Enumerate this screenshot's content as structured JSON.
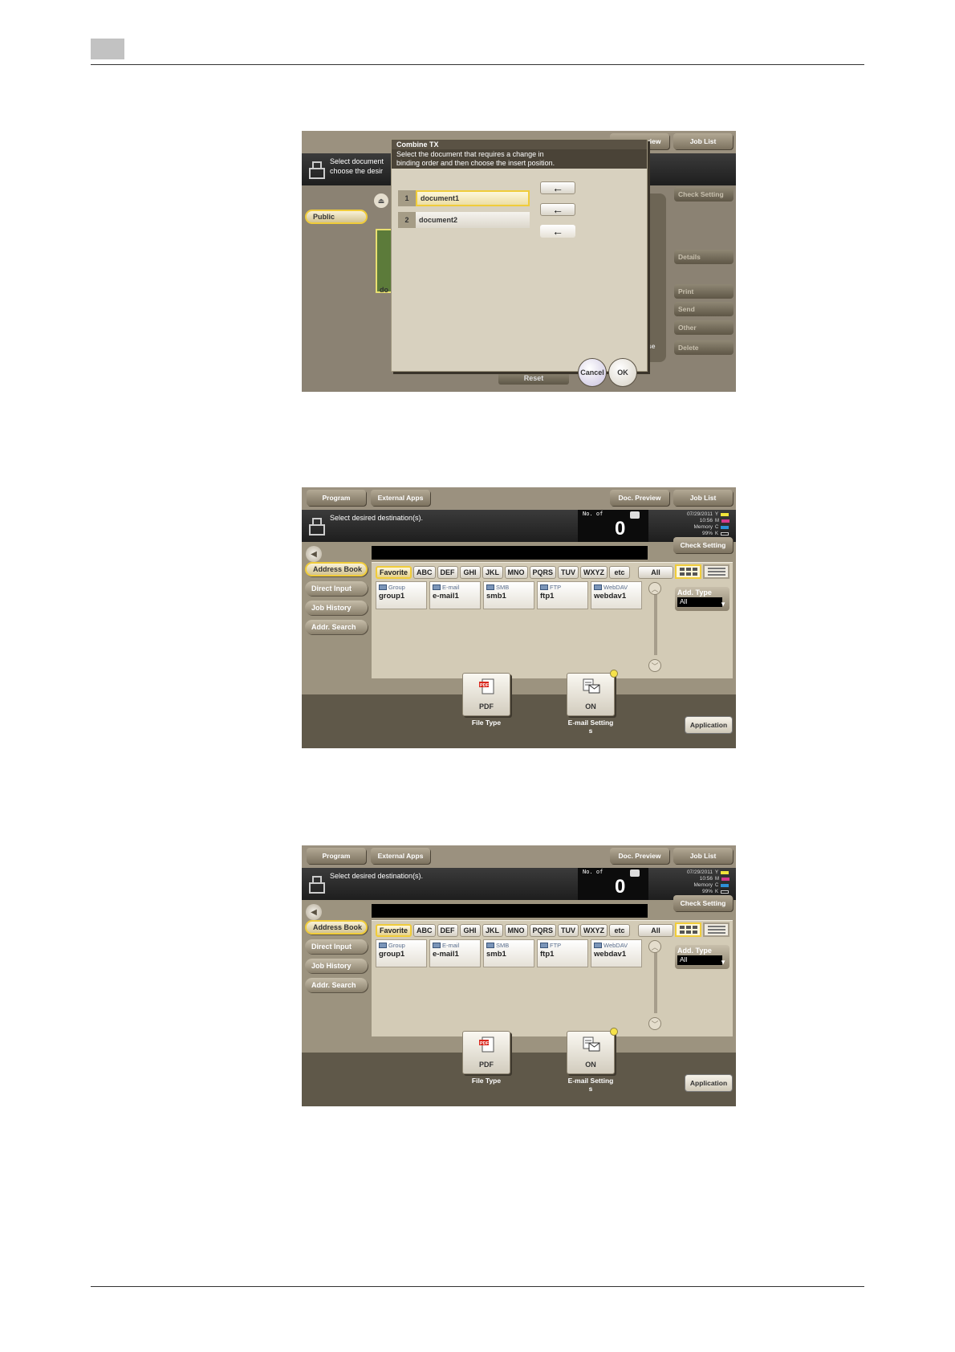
{
  "panel1": {
    "topbar": {
      "doc_preview": "Doc. Preview",
      "job_list": "Job List"
    },
    "msg_line1": "Select document",
    "msg_line2": "choose the desir",
    "public_label": "Public",
    "thumb_label": "do",
    "check_setting": "Check Setting",
    "right_buttons": {
      "details": "Details",
      "print": "Print",
      "send": "Send",
      "other": "Other",
      "delete": "Delete"
    },
    "reset": "Reset",
    "se": "se",
    "dialog": {
      "title": "Combine TX",
      "message_line1": "Select the document that requires a change in",
      "message_line2": "binding order and  then choose the insert position.",
      "documents": [
        {
          "num": "1",
          "name": "document1",
          "selected": true
        },
        {
          "num": "2",
          "name": "document2",
          "selected": false
        }
      ],
      "arrow_glyph": "←",
      "cancel": "Cancel",
      "ok": "OK"
    }
  },
  "panel_common": {
    "topbar": {
      "program": "Program",
      "external_apps": "External Apps",
      "doc_preview": "Doc. Preview",
      "job_list": "Job List"
    },
    "message": "Select desired destination(s).",
    "counter_label": "No. of",
    "counter_value": "0",
    "status": {
      "date": "07/29/2011",
      "time": "10:56",
      "memory_label": "Memory",
      "memory_value": "99%"
    },
    "toner": [
      {
        "label": "Y",
        "color": "#f2e43a"
      },
      {
        "label": "M",
        "color": "#d43a8c"
      },
      {
        "label": "C",
        "color": "#2e8fd6"
      },
      {
        "label": "K",
        "color": "#111111"
      }
    ],
    "check_setting": "Check Setting",
    "side_tabs": [
      "Address Book",
      "Direct Input",
      "Job History",
      "Addr. Search"
    ],
    "index_tabs": [
      "Favorite",
      "ABC",
      "DEF",
      "GHI",
      "JKL",
      "MNO",
      "PQRS",
      "TUV",
      "WXYZ",
      "etc"
    ],
    "index_all": "All",
    "destinations": [
      {
        "type": "Group",
        "name": "group1"
      },
      {
        "type": "E-mail",
        "name": "e-mail1"
      },
      {
        "type": "SMB",
        "name": "smb1"
      },
      {
        "type": "FTP",
        "name": "ftp1"
      },
      {
        "type": "WebDAV",
        "name": "webdav1"
      }
    ],
    "add_type_label": "Add. Type",
    "add_type_value": "All",
    "file_type_value": "PDF",
    "file_type_caption": "File Type",
    "email_setting_value": "ON",
    "email_setting_caption_1": "E-mail Setting",
    "email_setting_caption_2": "s",
    "application": "Application"
  }
}
